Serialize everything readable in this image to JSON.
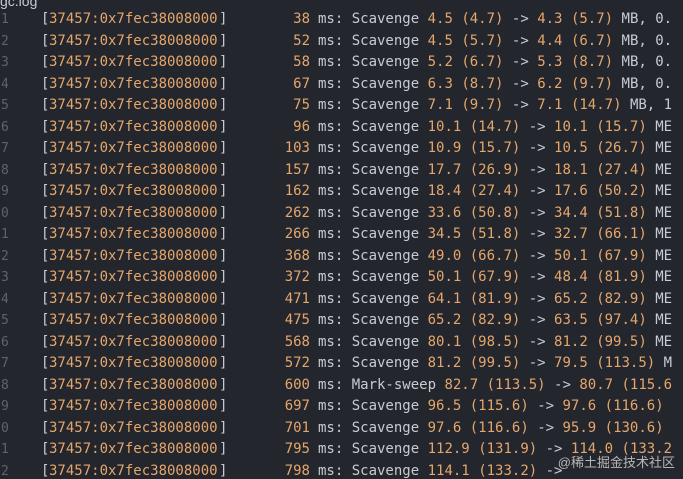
{
  "tab": {
    "title": "gc.log"
  },
  "colors": {
    "background": "#23262d",
    "text": "#c8ccd2",
    "number": "#e5a66c",
    "gutter": "#5c6370"
  },
  "lines": [
    {
      "n": "1",
      "pid": "37457:0x7fec38008000",
      "ms": "38",
      "type": "Scavenge",
      "a": "4.5",
      "b": "(4.7)",
      "c": "4.3",
      "d": "(5.7)",
      "tail": " MB, 0."
    },
    {
      "n": "2",
      "pid": "37457:0x7fec38008000",
      "ms": "52",
      "type": "Scavenge",
      "a": "4.5",
      "b": "(5.7)",
      "c": "4.4",
      "d": "(6.7)",
      "tail": " MB, 0."
    },
    {
      "n": "3",
      "pid": "37457:0x7fec38008000",
      "ms": "58",
      "type": "Scavenge",
      "a": "5.2",
      "b": "(6.7)",
      "c": "5.3",
      "d": "(8.7)",
      "tail": " MB, 0."
    },
    {
      "n": "4",
      "pid": "37457:0x7fec38008000",
      "ms": "67",
      "type": "Scavenge",
      "a": "6.3",
      "b": "(8.7)",
      "c": "6.2",
      "d": "(9.7)",
      "tail": " MB, 0."
    },
    {
      "n": "5",
      "pid": "37457:0x7fec38008000",
      "ms": "75",
      "type": "Scavenge",
      "a": "7.1",
      "b": "(9.7)",
      "c": "7.1",
      "d": "(14.7)",
      "tail": " MB, 1"
    },
    {
      "n": "6",
      "pid": "37457:0x7fec38008000",
      "ms": "96",
      "type": "Scavenge",
      "a": "10.1",
      "b": "(14.7)",
      "c": "10.1",
      "d": "(15.7)",
      "tail": " ME"
    },
    {
      "n": "7",
      "pid": "37457:0x7fec38008000",
      "ms": "103",
      "type": "Scavenge",
      "a": "10.9",
      "b": "(15.7)",
      "c": "10.5",
      "d": "(26.7)",
      "tail": " ME"
    },
    {
      "n": "8",
      "pid": "37457:0x7fec38008000",
      "ms": "157",
      "type": "Scavenge",
      "a": "17.7",
      "b": "(26.9)",
      "c": "18.1",
      "d": "(27.4)",
      "tail": " ME"
    },
    {
      "n": "9",
      "pid": "37457:0x7fec38008000",
      "ms": "162",
      "type": "Scavenge",
      "a": "18.4",
      "b": "(27.4)",
      "c": "17.6",
      "d": "(50.2)",
      "tail": " ME"
    },
    {
      "n": "0",
      "pid": "37457:0x7fec38008000",
      "ms": "262",
      "type": "Scavenge",
      "a": "33.6",
      "b": "(50.8)",
      "c": "34.4",
      "d": "(51.8)",
      "tail": " ME"
    },
    {
      "n": "1",
      "pid": "37457:0x7fec38008000",
      "ms": "266",
      "type": "Scavenge",
      "a": "34.5",
      "b": "(51.8)",
      "c": "32.7",
      "d": "(66.1)",
      "tail": " ME"
    },
    {
      "n": "2",
      "pid": "37457:0x7fec38008000",
      "ms": "368",
      "type": "Scavenge",
      "a": "49.0",
      "b": "(66.7)",
      "c": "50.1",
      "d": "(67.9)",
      "tail": " ME"
    },
    {
      "n": "3",
      "pid": "37457:0x7fec38008000",
      "ms": "372",
      "type": "Scavenge",
      "a": "50.1",
      "b": "(67.9)",
      "c": "48.4",
      "d": "(81.9)",
      "tail": " ME"
    },
    {
      "n": "4",
      "pid": "37457:0x7fec38008000",
      "ms": "471",
      "type": "Scavenge",
      "a": "64.1",
      "b": "(81.9)",
      "c": "65.2",
      "d": "(82.9)",
      "tail": " ME"
    },
    {
      "n": "5",
      "pid": "37457:0x7fec38008000",
      "ms": "475",
      "type": "Scavenge",
      "a": "65.2",
      "b": "(82.9)",
      "c": "63.5",
      "d": "(97.4)",
      "tail": " ME"
    },
    {
      "n": "6",
      "pid": "37457:0x7fec38008000",
      "ms": "568",
      "type": "Scavenge",
      "a": "80.1",
      "b": "(98.5)",
      "c": "81.2",
      "d": "(99.5)",
      "tail": " ME"
    },
    {
      "n": "7",
      "pid": "37457:0x7fec38008000",
      "ms": "572",
      "type": "Scavenge",
      "a": "81.2",
      "b": "(99.5)",
      "c": "79.5",
      "d": "(113.5)",
      "tail": " M"
    },
    {
      "n": "8",
      "pid": "37457:0x7fec38008000",
      "ms": "600",
      "type": "Mark-sweep",
      "a": "82.7",
      "b": "(113.5)",
      "c": "80.7",
      "d": "(115.6",
      "tail": ""
    },
    {
      "n": "9",
      "pid": "37457:0x7fec38008000",
      "ms": "697",
      "type": "Scavenge",
      "a": "96.5",
      "b": "(115.6)",
      "c": "97.6",
      "d": "(116.6)",
      "tail": ""
    },
    {
      "n": "0",
      "pid": "37457:0x7fec38008000",
      "ms": "701",
      "type": "Scavenge",
      "a": "97.6",
      "b": "(116.6)",
      "c": "95.9",
      "d": "(130.6)",
      "tail": ""
    },
    {
      "n": "1",
      "pid": "37457:0x7fec38008000",
      "ms": "795",
      "type": "Scavenge",
      "a": "112.9",
      "b": "(131.9)",
      "c": "114.0",
      "d": "(133.2",
      "tail": ""
    },
    {
      "n": "2",
      "pid": "37457:0x7fec38008000",
      "ms": "798",
      "type": "Scavenge",
      "a": "114.1",
      "b": "(133.2)",
      "c": "",
      "d": "",
      "tail": ""
    }
  ],
  "watermark": "@稀土掘金技术社区"
}
